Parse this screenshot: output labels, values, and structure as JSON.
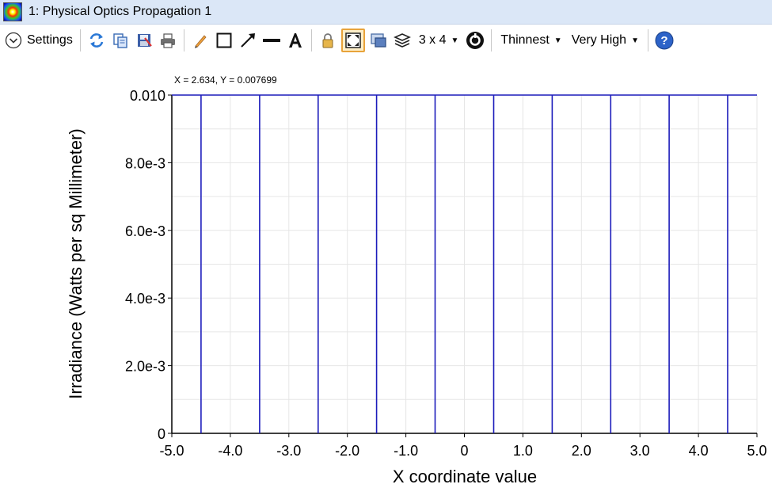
{
  "window": {
    "title": "1: Physical Optics Propagation 1",
    "app_icon": "beam-irradiance-icon"
  },
  "toolbar": {
    "settings_label": "Settings",
    "layout_label": "3 x 4",
    "line_width_label": "Thinnest",
    "resolution_label": "Very High",
    "icons": [
      "chevron-down-icon",
      "refresh-icon",
      "copy-icon",
      "save-icon",
      "print-icon",
      "pencil-icon",
      "rectangle-icon",
      "arrow-icon",
      "line-icon",
      "text-icon",
      "lock-icon",
      "fit-icon",
      "window-icon",
      "layers-icon",
      "timer-icon",
      "help-icon"
    ]
  },
  "readout": "X = 2.634, Y = 0.007699",
  "chart_data": {
    "type": "line",
    "xlabel": "X coordinate value",
    "ylabel": "Irradiance (Watts per sq Millimeter)",
    "xlim": [
      -5.0,
      5.0
    ],
    "ylim": [
      0,
      0.01
    ],
    "xticks": [
      -5.0,
      -4.0,
      -3.0,
      -2.0,
      -1.0,
      0,
      1.0,
      2.0,
      3.0,
      4.0,
      5.0
    ],
    "xtick_labels": [
      "-5.0",
      "-4.0",
      "-3.0",
      "-2.0",
      "-1.0",
      "0",
      "1.0",
      "2.0",
      "3.0",
      "4.0",
      "5.0"
    ],
    "yticks": [
      0,
      0.002,
      0.004,
      0.006,
      0.008,
      0.01
    ],
    "ytick_labels": [
      "0",
      "2.0e-3",
      "4.0e-3",
      "6.0e-3",
      "8.0e-3",
      "0.010"
    ],
    "grid": true,
    "series": [
      {
        "color": "#1c1cbb",
        "x": [
          -5.0,
          -4.5,
          -4.5,
          -4.5,
          -3.5,
          -3.5,
          -3.5,
          -2.5,
          -2.5,
          -2.5,
          -1.5,
          -1.5,
          -1.5,
          -0.5,
          -0.5,
          -0.5,
          0.5,
          0.5,
          0.5,
          1.5,
          1.5,
          1.5,
          2.5,
          2.5,
          2.5,
          3.5,
          3.5,
          3.5,
          4.5,
          4.5,
          4.5,
          5.0
        ],
        "y": [
          0.01,
          0.01,
          0,
          0.01,
          0.01,
          0,
          0.01,
          0.01,
          0,
          0.01,
          0.01,
          0,
          0.01,
          0.01,
          0,
          0.01,
          0.01,
          0,
          0.01,
          0.01,
          0,
          0.01,
          0.01,
          0,
          0.01,
          0.01,
          0,
          0.01,
          0.01,
          0,
          0.01,
          0.01
        ]
      }
    ]
  }
}
